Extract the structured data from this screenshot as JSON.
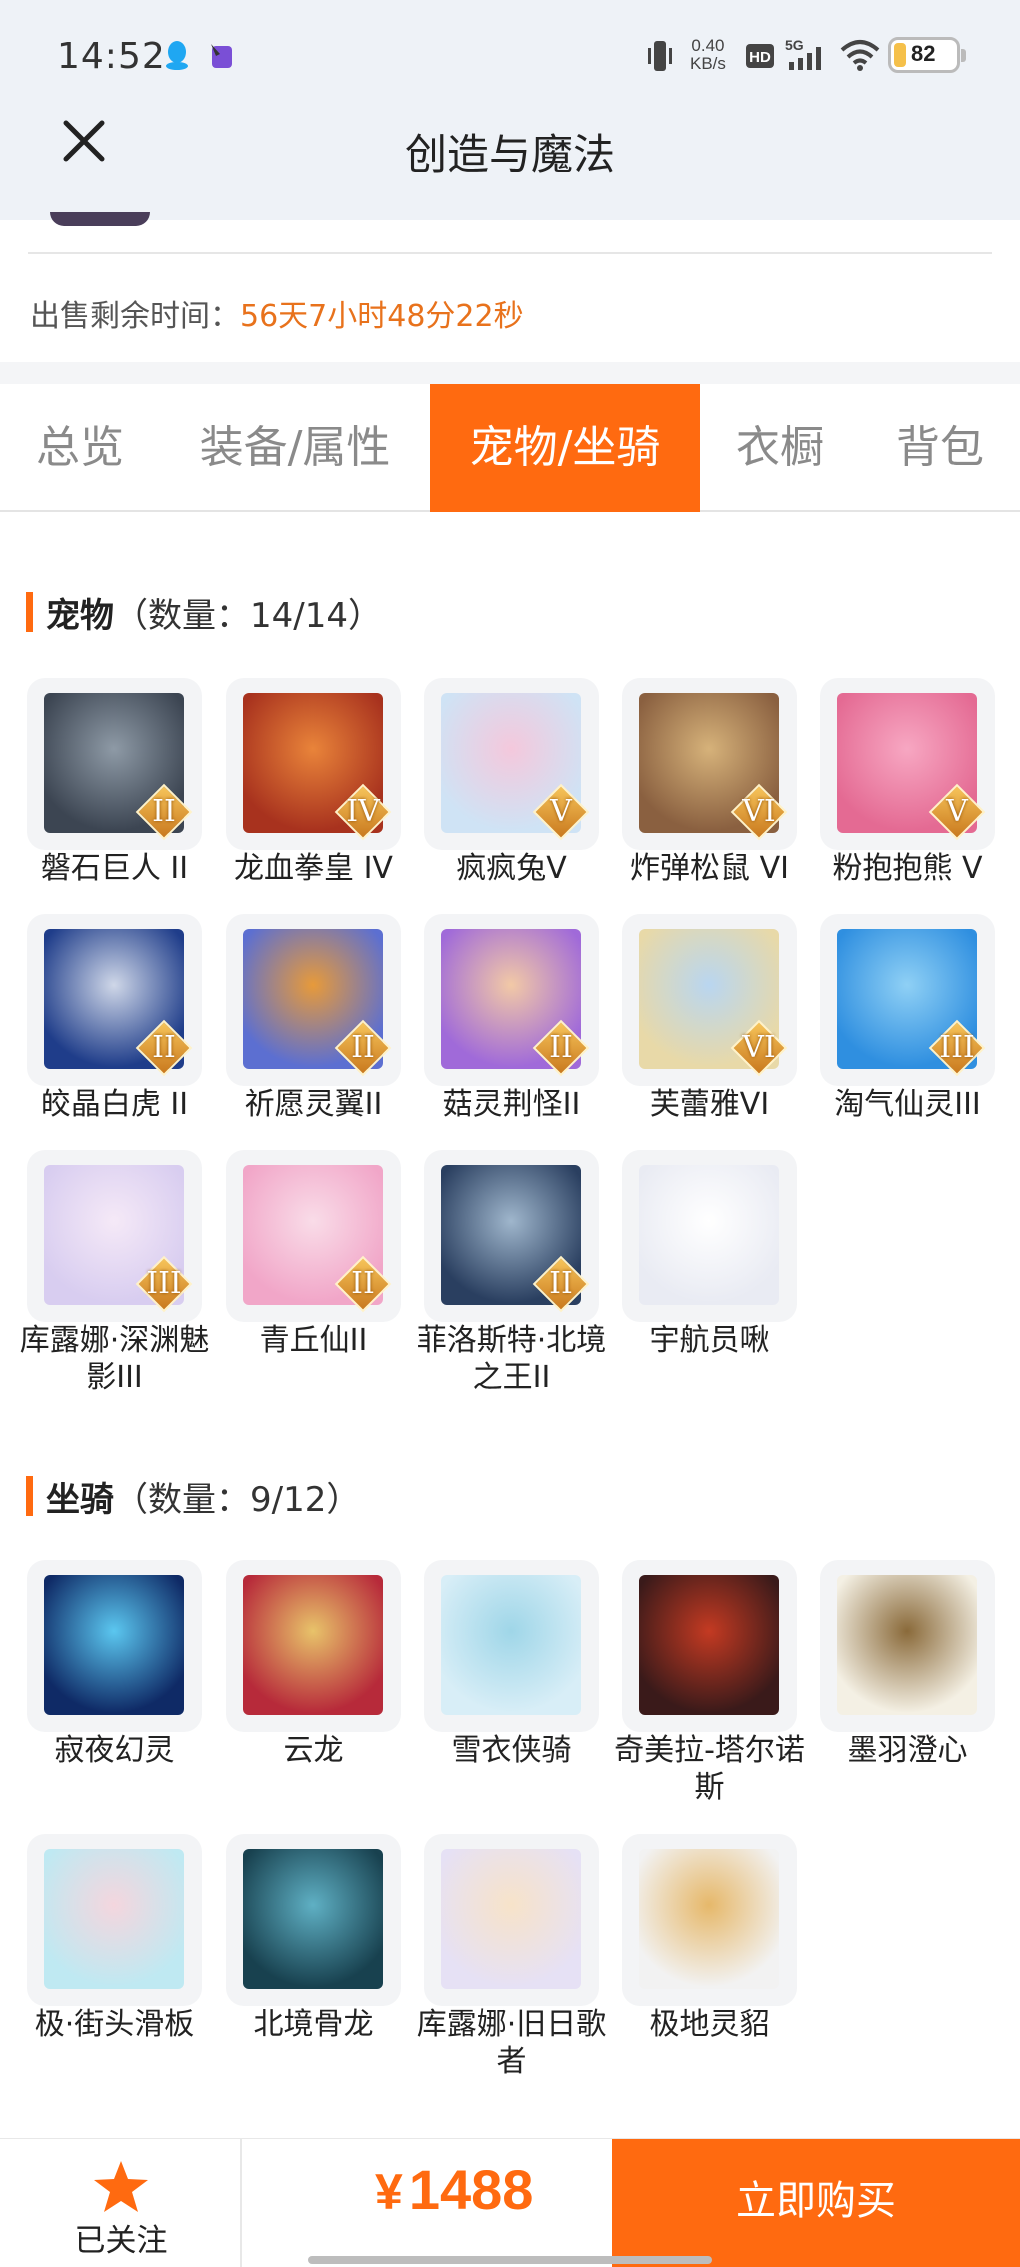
{
  "status_bar": {
    "time": "14:52",
    "net_speed_value": "0.40",
    "net_speed_unit": "KB/s",
    "network_type": "5G",
    "battery_level": "82",
    "icons": [
      "qq-icon",
      "app-icon",
      "vibrate-icon",
      "hd-icon",
      "signal-icon",
      "wifi-icon",
      "battery-icon"
    ]
  },
  "header": {
    "title": "创造与魔法",
    "close_icon": "close-icon"
  },
  "sale": {
    "label": "出售剩余时间：",
    "value": "56天7小时48分22秒",
    "value_color": "#e8721c"
  },
  "tabs": [
    {
      "label": "总览",
      "active": false
    },
    {
      "label": "装备/属性",
      "active": false
    },
    {
      "label": "宠物/坐骑",
      "active": true
    },
    {
      "label": "衣橱",
      "active": false
    },
    {
      "label": "背包",
      "active": false
    }
  ],
  "pets": {
    "title": "宠物",
    "count": "（数量：14/14）",
    "items": [
      {
        "name": "磐石巨人 II",
        "rank": "II",
        "colors": [
          "#3c4552",
          "#8e9aa6"
        ]
      },
      {
        "name": "龙血拳皇 IV",
        "rank": "IV",
        "colors": [
          "#a8321e",
          "#e9843a"
        ]
      },
      {
        "name": "疯疯兔V",
        "rank": "V",
        "colors": [
          "#cfe3f5",
          "#f4c8dc"
        ]
      },
      {
        "name": "炸弹松鼠 VI",
        "rank": "VI",
        "colors": [
          "#8a6040",
          "#d6b27a"
        ]
      },
      {
        "name": "粉抱抱熊 V",
        "rank": "V",
        "colors": [
          "#e46a93",
          "#f7a7c2"
        ]
      },
      {
        "name": "皎晶白虎 II",
        "rank": "II",
        "colors": [
          "#1f3d8a",
          "#cfd7e8"
        ]
      },
      {
        "name": "祈愿灵翼II",
        "rank": "II",
        "colors": [
          "#5c6fd1",
          "#e79a3a"
        ]
      },
      {
        "name": "菇灵荆怪II",
        "rank": "II",
        "colors": [
          "#a06ad9",
          "#f2c9a6"
        ]
      },
      {
        "name": "芙蕾雅VI",
        "rank": "VI",
        "colors": [
          "#e8d9a8",
          "#b9d6f0"
        ]
      },
      {
        "name": "淘气仙灵III",
        "rank": "III",
        "colors": [
          "#2f8fe0",
          "#8fd0f5"
        ]
      },
      {
        "name": "库露娜·深渊魅影III",
        "rank": "III",
        "colors": [
          "#d8cdf0",
          "#f5e9f7"
        ]
      },
      {
        "name": "青丘仙II",
        "rank": "II",
        "colors": [
          "#f1a6c8",
          "#f9dce8"
        ]
      },
      {
        "name": "菲洛斯特·北境之王II",
        "rank": "II",
        "colors": [
          "#2a3f60",
          "#9fb6cc"
        ]
      },
      {
        "name": "宇航员啾",
        "rank": "",
        "colors": [
          "#e9ebf3",
          "#ffffff"
        ]
      }
    ]
  },
  "mounts": {
    "title": "坐骑",
    "count": "（数量：9/12）",
    "items": [
      {
        "name": "寂夜幻灵",
        "colors": [
          "#0f2a66",
          "#5bc7f0"
        ]
      },
      {
        "name": "云龙",
        "colors": [
          "#b72a3a",
          "#e8c36a"
        ]
      },
      {
        "name": "雪衣侠骑",
        "colors": [
          "#d8eef7",
          "#9fd6e8"
        ]
      },
      {
        "name": "奇美拉-塔尔诺斯",
        "colors": [
          "#3a1a1a",
          "#c43a22"
        ]
      },
      {
        "name": "墨羽澄心",
        "colors": [
          "#f4f0e4",
          "#8a6a3a"
        ]
      },
      {
        "name": "极·街头滑板",
        "colors": [
          "#bfe9f2",
          "#f4d6de"
        ]
      },
      {
        "name": "北境骨龙",
        "colors": [
          "#18414f",
          "#5fb0c4"
        ]
      },
      {
        "name": "库露娜·旧日歌者",
        "colors": [
          "#e6e1f5",
          "#f7e3c9"
        ]
      },
      {
        "name": "极地灵貂",
        "colors": [
          "#f2f2f2",
          "#e6b86a"
        ]
      }
    ]
  },
  "bottom_bar": {
    "follow_label": "已关注",
    "currency": "¥",
    "price": "1488",
    "buy_label": "立即购买",
    "accent_color": "#ff6a10"
  }
}
